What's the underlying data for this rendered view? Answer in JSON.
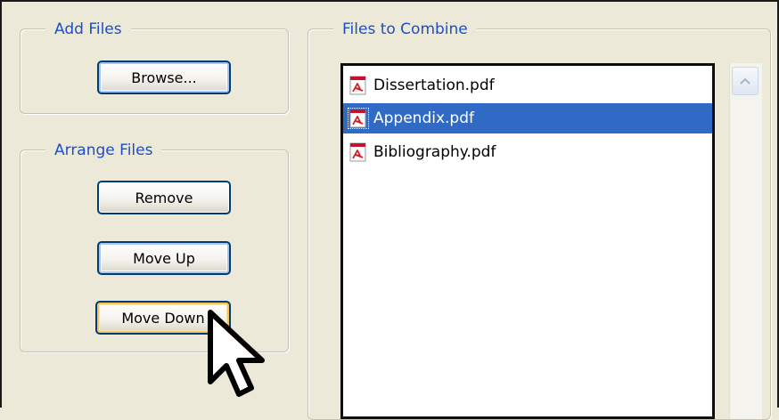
{
  "add_files": {
    "legend": "Add Files",
    "browse_label": "Browse..."
  },
  "arrange_files": {
    "legend": "Arrange Files",
    "remove_label": "Remove",
    "move_up_label": "Move Up",
    "move_down_label": "Move Down"
  },
  "files_to_combine": {
    "legend": "Files to Combine",
    "items": [
      {
        "name": "Dissertation.pdf",
        "icon": "pdf-icon",
        "selected": false
      },
      {
        "name": "Appendix.pdf",
        "icon": "pdf-icon",
        "selected": true
      },
      {
        "name": "Bibliography.pdf",
        "icon": "pdf-icon",
        "selected": false
      }
    ]
  },
  "colors": {
    "window_bg": "#ece9d8",
    "legend_text": "#1b4fc7",
    "selection_bg": "#316ac5",
    "button_border": "#003c74",
    "hover_highlight": "#f7c35a"
  },
  "cursor": {
    "icon": "arrow-cursor-icon"
  }
}
